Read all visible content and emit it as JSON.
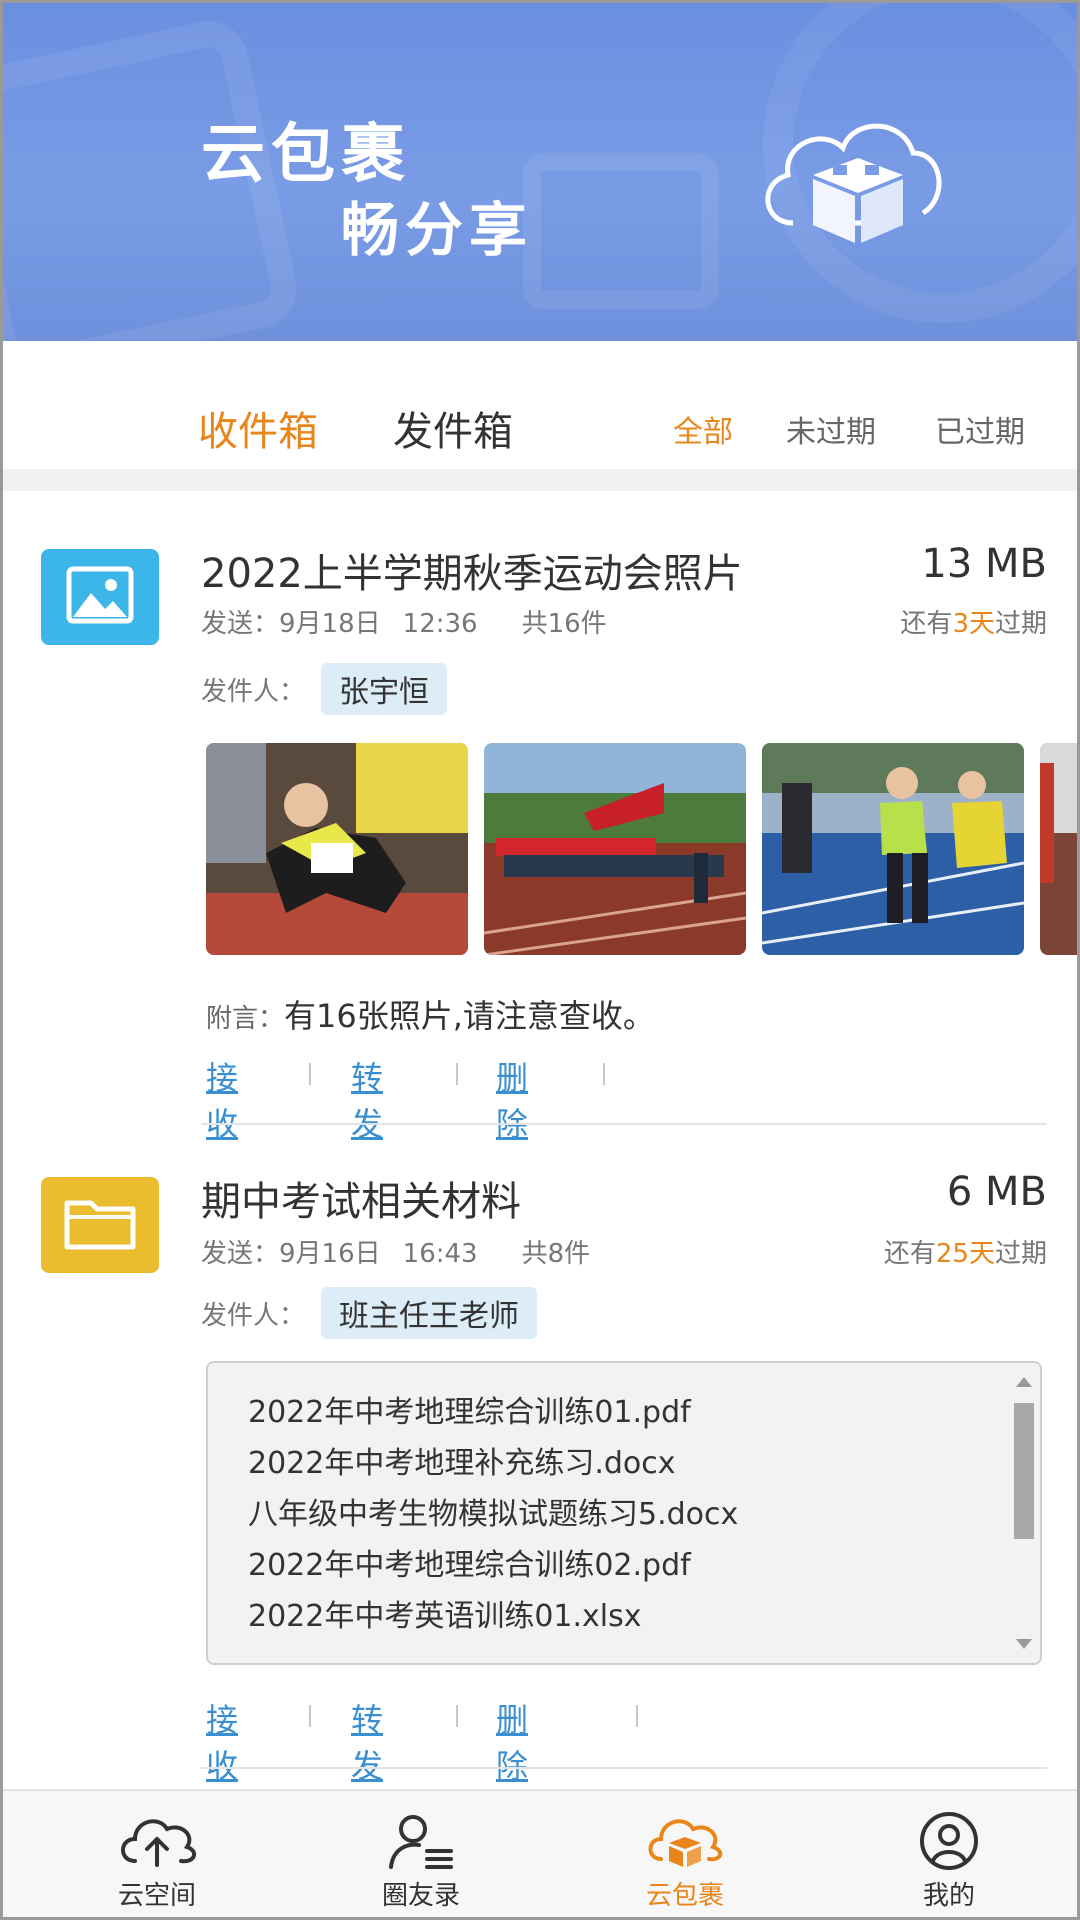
{
  "banner": {
    "line1": "云包裹",
    "line2": "畅分享"
  },
  "tabs": {
    "inbox": "收件箱",
    "outbox": "发件箱"
  },
  "filters": {
    "all": "全部",
    "unexpired": "未过期",
    "expired": "已过期"
  },
  "colors": {
    "accent": "#e8861a",
    "link": "#3a8fd0",
    "banner": "#7a9ce6"
  },
  "parcels": [
    {
      "icon": "image-icon",
      "title": "2022上半学期秋季运动会照片",
      "size": "13 MB",
      "sent_label": "发送：",
      "sent_date": "9月18日",
      "sent_time": "12:36",
      "count": "共16件",
      "expire_prefix": "还有",
      "expire_days": "3天",
      "expire_suffix": "过期",
      "sender_label": "发件人：",
      "sender": "张宇恒",
      "note_label": "附言：",
      "note": "有16张照片,请注意查收。",
      "actions": {
        "receive": "接收",
        "forward": "转发",
        "delete": "删除"
      }
    },
    {
      "icon": "folder-icon",
      "title": "期中考试相关材料",
      "size": "6 MB",
      "sent_label": "发送：",
      "sent_date": "9月16日",
      "sent_time": "16:43",
      "count": "共8件",
      "expire_prefix": "还有",
      "expire_days": "25天",
      "expire_suffix": "过期",
      "sender_label": "发件人：",
      "sender": "班主任王老师",
      "files": [
        "2022年中考地理综合训练01.pdf",
        "2022年中考地理补充练习.docx",
        "八年级中考生物模拟试题练习5.docx",
        "2022年中考地理综合训练02.pdf",
        "2022年中考英语训练01.xlsx"
      ],
      "actions": {
        "receive": "接收",
        "forward": "转发",
        "delete": "删除"
      }
    }
  ],
  "bottom_nav": [
    {
      "label": "云空间",
      "icon": "cloud-upload-icon"
    },
    {
      "label": "圈友录",
      "icon": "contacts-icon"
    },
    {
      "label": "云包裹",
      "icon": "cloud-parcel-icon",
      "active": true
    },
    {
      "label": "我的",
      "icon": "user-icon"
    }
  ]
}
